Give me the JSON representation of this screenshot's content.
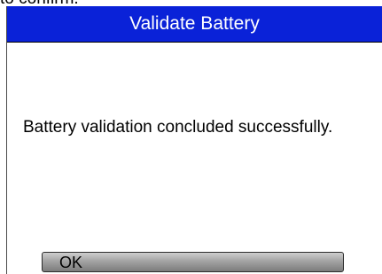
{
  "background_text": "to confirm.",
  "dialog": {
    "title": "Validate Battery",
    "message": "Battery validation concluded successfully.",
    "ok_label": "OK"
  },
  "colors": {
    "title_bar": "#0a22d8",
    "title_text": "#ffffff",
    "button_gradient_top": "#cfcfcf",
    "button_gradient_bottom": "#7c7c7c"
  }
}
